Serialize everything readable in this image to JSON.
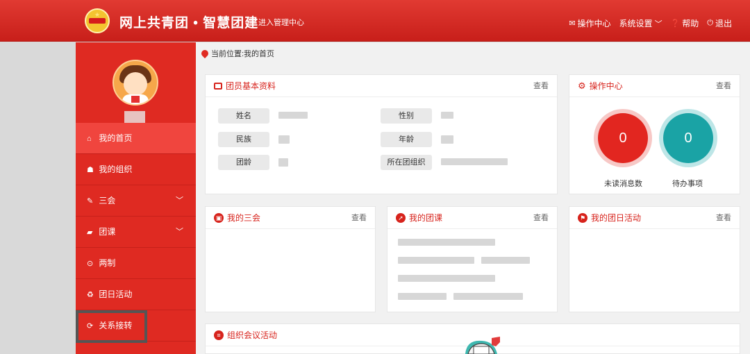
{
  "header": {
    "site_title": "网上共青团 • 智慧团建",
    "enter_admin": "进入管理中心",
    "nav": [
      {
        "icon": "mail-icon",
        "label": "操作中心"
      },
      {
        "icon": "",
        "label": "系统设置"
      },
      {
        "icon": "question-icon",
        "label": "帮助"
      },
      {
        "icon": "power-icon",
        "label": "退出"
      }
    ]
  },
  "sidebar": {
    "items": [
      {
        "icon": "home-icon",
        "label": "我的首页",
        "active": true
      },
      {
        "icon": "group-icon",
        "label": "我的组织"
      },
      {
        "icon": "edit-icon",
        "label": "三会",
        "expandable": true
      },
      {
        "icon": "folder-icon",
        "label": "团课",
        "expandable": true
      },
      {
        "icon": "target-icon",
        "label": "两制"
      },
      {
        "icon": "recycle-icon",
        "label": "团日活动"
      },
      {
        "icon": "refresh-icon",
        "label": "关系接转"
      }
    ]
  },
  "breadcrumb": "当前位置:我的首页",
  "profile_panel": {
    "title": "团员基本资料",
    "view": "查看",
    "fields": [
      "姓名",
      "性别",
      "民族",
      "年龄",
      "团龄",
      "所在团组织"
    ]
  },
  "ops_panel": {
    "title": "操作中心",
    "view": "查看",
    "unread_count": "0",
    "unread_label": "未读消息数",
    "todo_count": "0",
    "todo_label": "待办事项"
  },
  "three_meetings_panel": {
    "title": "我的三会",
    "view": "查看"
  },
  "league_class_panel": {
    "title": "我的团课",
    "view": "查看"
  },
  "league_day_panel": {
    "title": "我的团日活动",
    "view": "查看"
  },
  "org_meeting_panel": {
    "title": "组织会议活动"
  },
  "colors": {
    "brand_red": "#d7231c",
    "teal": "#1aa3a5"
  }
}
